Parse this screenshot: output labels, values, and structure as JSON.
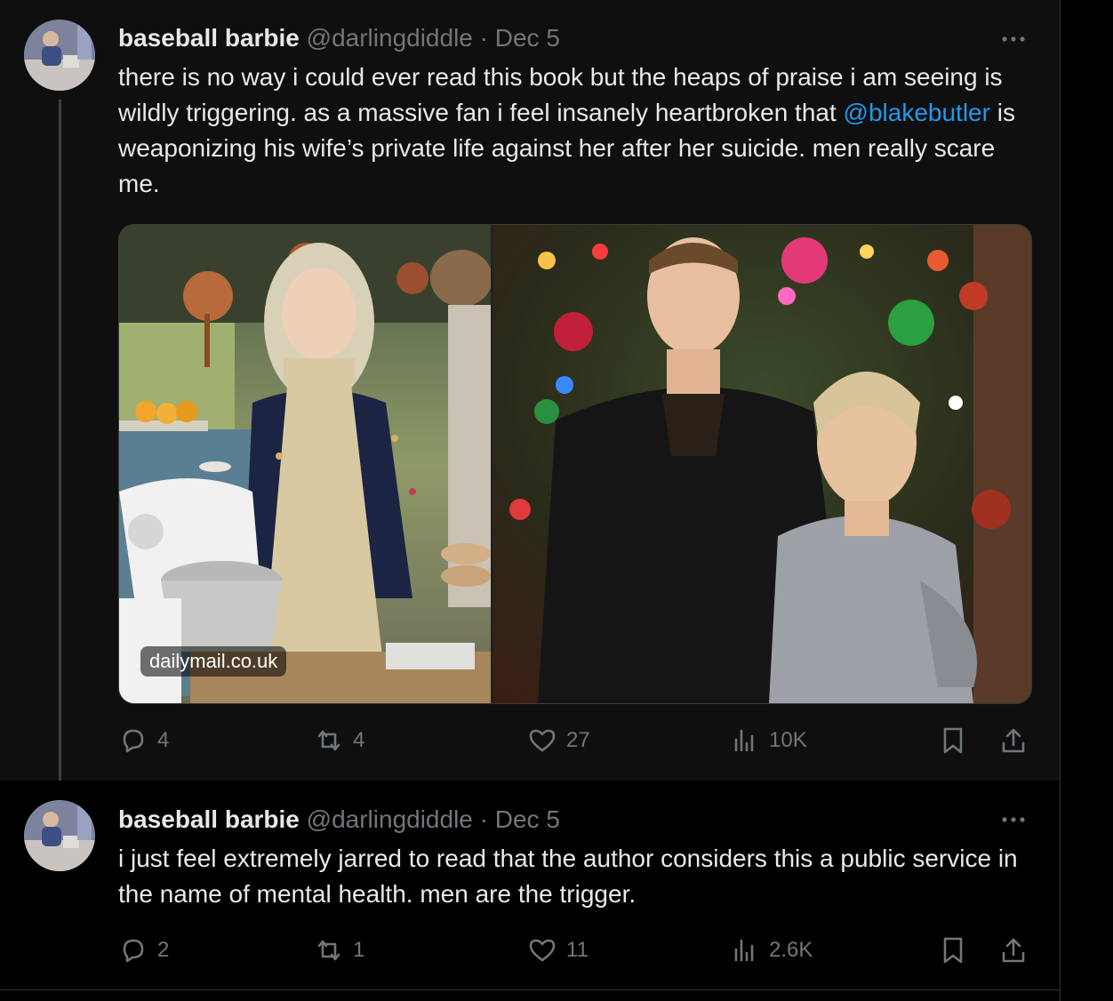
{
  "tweets": [
    {
      "name": "baseball barbie",
      "handle": "@darlingdiddle",
      "separator": "·",
      "date": "Dec 5",
      "text_before_mention": "there is no way i could ever read this book but the heaps of praise i am seeing is wildly triggering. as a massive fan i feel insanely heartbroken that ",
      "mention": "@blakebutler",
      "text_after_mention": " is weaponizing his wife’s private life against her after her suicide. men really scare me.",
      "media_source": "dailymail.co.uk",
      "stats": {
        "replies": "4",
        "reposts": "4",
        "likes": "27",
        "views": "10K"
      }
    },
    {
      "name": "baseball barbie",
      "handle": "@darlingdiddle",
      "separator": "·",
      "date": "Dec 5",
      "text": "i just feel extremely jarred to read that the author considers this a public service in the name of mental health. men are the trigger.",
      "stats": {
        "replies": "2",
        "reposts": "1",
        "likes": "11",
        "views": "2.6K"
      }
    }
  ],
  "icons": {
    "reply": "reply-icon",
    "repost": "repost-icon",
    "like": "like-icon",
    "views": "views-icon",
    "bookmark": "bookmark-icon",
    "share": "share-icon",
    "more": "more-icon"
  },
  "colors": {
    "background": "#000000",
    "thread_background": "#0f0f0f",
    "text": "#e7e9ea",
    "muted": "#71767b",
    "link": "#1d9bf0"
  }
}
